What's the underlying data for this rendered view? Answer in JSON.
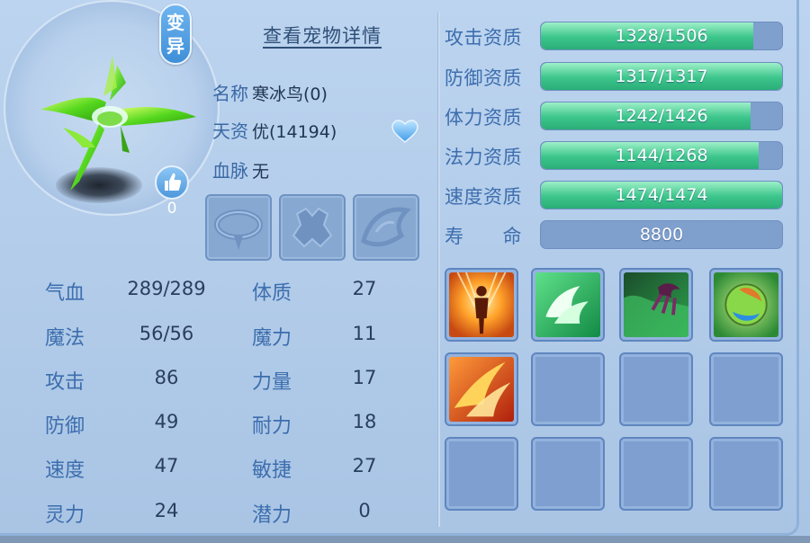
{
  "pet": {
    "mutation_badge": [
      "变",
      "异"
    ],
    "like_count": "0",
    "detail_title": "查看宠物详情",
    "name_label": "名称",
    "name_value": "寒冰鸟(0)",
    "talent_label": "天资",
    "talent_value": "优(14194)",
    "blood_label": "血脉",
    "blood_value": "无"
  },
  "stats": [
    {
      "label": "气血",
      "value": "289/289",
      "label2": "体质",
      "value2": "27"
    },
    {
      "label": "魔法",
      "value": "56/56",
      "label2": "魔力",
      "value2": "11"
    },
    {
      "label": "攻击",
      "value": "86",
      "label2": "力量",
      "value2": "17"
    },
    {
      "label": "防御",
      "value": "49",
      "label2": "耐力",
      "value2": "18"
    },
    {
      "label": "速度",
      "value": "47",
      "label2": "敏捷",
      "value2": "27"
    },
    {
      "label": "灵力",
      "value": "24",
      "label2": "潜力",
      "value2": "0"
    }
  ],
  "aptitudes": [
    {
      "label": "攻击资质",
      "text": "1328/1506",
      "fill": 0.882
    },
    {
      "label": "防御资质",
      "text": "1317/1317",
      "fill": 1.0
    },
    {
      "label": "体力资质",
      "text": "1242/1426",
      "fill": 0.871
    },
    {
      "label": "法力资质",
      "text": "1144/1268",
      "fill": 0.902
    },
    {
      "label": "速度资质",
      "text": "1474/1474",
      "fill": 1.0
    },
    {
      "label": "寿　　命",
      "text": "8800",
      "fill": 0.0
    }
  ],
  "skills": [
    "skill-figure-icon",
    "skill-wings-icon",
    "skill-claw-icon",
    "skill-orb-icon",
    "skill-fire-slash-icon"
  ],
  "colors": {
    "accent": "#3d6eae",
    "bar_fill": "#3cc58c",
    "bar_bg": "#7f9fcd"
  }
}
